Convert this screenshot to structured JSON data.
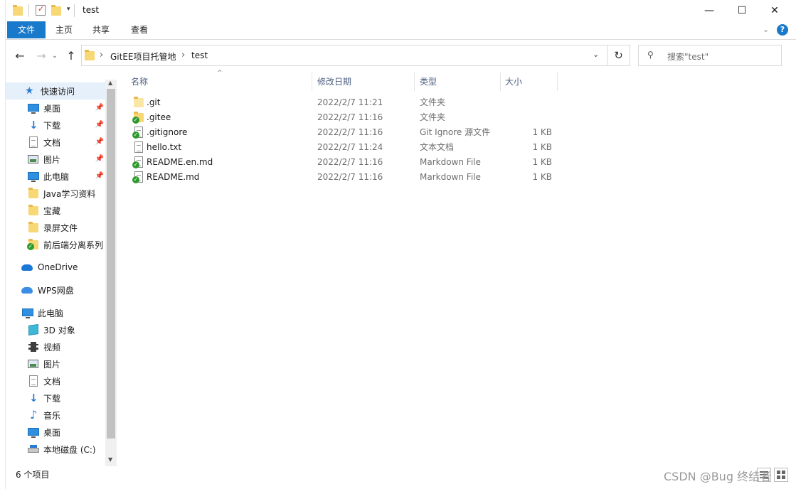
{
  "window": {
    "title": "test",
    "controls": {
      "minimize": "—",
      "maximize": "☐",
      "close": "✕"
    }
  },
  "ribbon": {
    "tabs": [
      "文件",
      "主页",
      "共享",
      "查看"
    ],
    "help_icon": "?"
  },
  "address": {
    "breadcrumb": [
      "GitEE项目托管地",
      "test"
    ],
    "separator": "›"
  },
  "search": {
    "placeholder": "搜索\"test\""
  },
  "nav_pane": {
    "items": [
      {
        "label": "快速访问",
        "icon": "star-icon",
        "pinned": false
      },
      {
        "label": "桌面",
        "icon": "desktop-icon",
        "pinned": true
      },
      {
        "label": "下载",
        "icon": "download-icon",
        "pinned": true
      },
      {
        "label": "文档",
        "icon": "document-icon",
        "pinned": true
      },
      {
        "label": "图片",
        "icon": "picture-icon",
        "pinned": true
      },
      {
        "label": "此电脑",
        "icon": "computer-icon",
        "pinned": true
      },
      {
        "label": "Java学习资料",
        "icon": "folder-icon",
        "pinned": false
      },
      {
        "label": "宝藏",
        "icon": "folder-icon",
        "pinned": false
      },
      {
        "label": "录屏文件",
        "icon": "folder-icon",
        "pinned": false
      },
      {
        "label": "前后端分离系列",
        "icon": "folder-check-icon",
        "pinned": false
      },
      {
        "label": "OneDrive",
        "icon": "onedrive-icon",
        "pinned": false
      },
      {
        "label": "WPS网盘",
        "icon": "wps-cloud-icon",
        "pinned": false
      },
      {
        "label": "此电脑",
        "icon": "computer-icon",
        "pinned": false
      },
      {
        "label": "3D 对象",
        "icon": "cube-icon",
        "pinned": false
      },
      {
        "label": "视频",
        "icon": "video-icon",
        "pinned": false
      },
      {
        "label": "图片",
        "icon": "picture-icon",
        "pinned": false
      },
      {
        "label": "文档",
        "icon": "document-icon",
        "pinned": false
      },
      {
        "label": "下载",
        "icon": "download-icon",
        "pinned": false
      },
      {
        "label": "音乐",
        "icon": "music-icon",
        "pinned": false
      },
      {
        "label": "桌面",
        "icon": "desktop-icon",
        "pinned": false
      },
      {
        "label": "本地磁盘 (C:)",
        "icon": "drive-icon",
        "pinned": false
      }
    ]
  },
  "file_list": {
    "columns": [
      "名称",
      "修改日期",
      "类型",
      "大小"
    ],
    "sort_indicator": "^",
    "rows": [
      {
        "name": ".git",
        "date": "2022/2/7 11:21",
        "type": "文件夹",
        "size": "",
        "icon": "folder-icon"
      },
      {
        "name": ".gitee",
        "date": "2022/2/7 11:16",
        "type": "文件夹",
        "size": "",
        "icon": "folder-check-icon"
      },
      {
        "name": ".gitignore",
        "date": "2022/2/7 11:16",
        "type": "Git Ignore 源文件",
        "size": "1 KB",
        "icon": "file-check-icon"
      },
      {
        "name": "hello.txt",
        "date": "2022/2/7 11:24",
        "type": "文本文档",
        "size": "1 KB",
        "icon": "text-file-icon"
      },
      {
        "name": "README.en.md",
        "date": "2022/2/7 11:16",
        "type": "Markdown File",
        "size": "1 KB",
        "icon": "file-check-icon"
      },
      {
        "name": "README.md",
        "date": "2022/2/7 11:16",
        "type": "Markdown File",
        "size": "1 KB",
        "icon": "file-check-icon"
      }
    ]
  },
  "status_bar": {
    "item_count": "6 个项目"
  },
  "watermark": "CSDN @Bug 终结者"
}
